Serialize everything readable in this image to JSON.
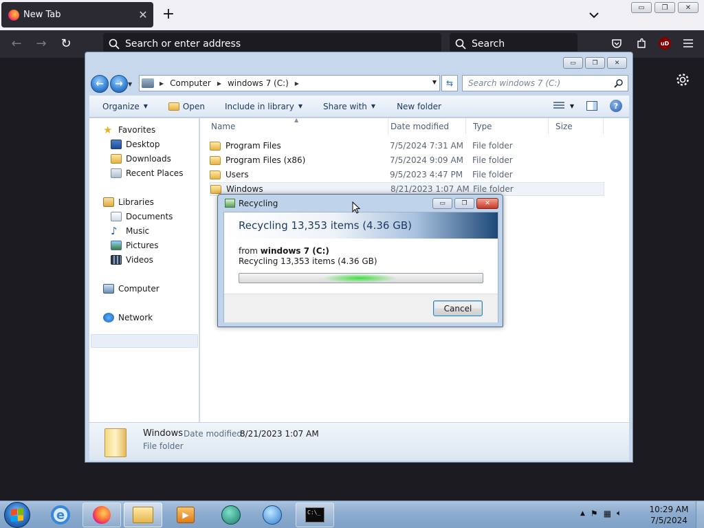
{
  "firefox": {
    "tab_title": "New Tab",
    "tab_close": "✕",
    "new_tab": "+",
    "url_placeholder": "Search or enter address",
    "search_placeholder": "Search",
    "ublock_label": "uD"
  },
  "explorer": {
    "address": {
      "crumbs": [
        "Computer",
        "windows 7 (C:)"
      ]
    },
    "search_placeholder": "Search windows 7 (C:)",
    "commands": {
      "organize": "Organize",
      "open": "Open",
      "include_in_library": "Include in library",
      "share_with": "Share with",
      "new_folder": "New folder"
    },
    "nav": {
      "favorites": "Favorites",
      "desktop": "Desktop",
      "downloads": "Downloads",
      "recent_places": "Recent Places",
      "libraries": "Libraries",
      "documents": "Documents",
      "music": "Music",
      "pictures": "Pictures",
      "videos": "Videos",
      "computer": "Computer",
      "network": "Network"
    },
    "columns": {
      "name": "Name",
      "date_modified": "Date modified",
      "type": "Type",
      "size": "Size"
    },
    "files": [
      {
        "name": "Program Files",
        "date": "7/5/2024 7:31 AM",
        "type": "File folder"
      },
      {
        "name": "Program Files (x86)",
        "date": "7/5/2024 9:09 AM",
        "type": "File folder"
      },
      {
        "name": "Users",
        "date": "9/5/2023 4:47 PM",
        "type": "File folder"
      },
      {
        "name": "Windows",
        "date": "8/21/2023 1:07 AM",
        "type": "File folder"
      }
    ],
    "details": {
      "name": "Windows",
      "date_label": "Date modified:",
      "date_value": "8/21/2023 1:07 AM",
      "type": "File folder"
    }
  },
  "dialog": {
    "title": "Recycling",
    "heading": "Recycling 13,353 items (4.36 GB)",
    "from_prefix": "from",
    "from_location": "windows 7 (C:)",
    "status": "Recycling 13,353 items (4.36 GB)",
    "cancel_label": "Cancel"
  },
  "taskbar": {
    "time": "10:29 AM",
    "date": "7/5/2024",
    "cmd_label": "C:\\_"
  }
}
